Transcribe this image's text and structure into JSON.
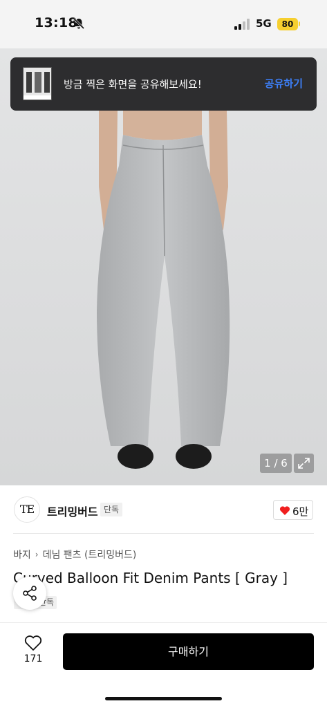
{
  "status_bar": {
    "time": "13:18",
    "network": "5G",
    "battery": "80",
    "icons": [
      "bell-slash-icon",
      "signal-icon"
    ]
  },
  "toast": {
    "message": "방금 찍은 화면을 공유해보세요!",
    "action": "공유하기"
  },
  "gallery": {
    "counter": "1 / 6",
    "expand_icon": "expand-icon"
  },
  "brand": {
    "logo_text": "TE",
    "name": "트리밍버드",
    "badge": "단독",
    "likes": "6만",
    "like_color": "#f01f1f"
  },
  "breadcrumb": [
    "바지",
    "데님 팬츠 (트리밍버드)"
  ],
  "product": {
    "title": "Curved Balloon Fit Denim Pants [ Gray ]",
    "badge": "단독"
  },
  "share_icon": "share-icon",
  "bottom_bar": {
    "wish_count": "171",
    "buy_label": "구매하기"
  },
  "colors": {
    "toast_bg": "#2d2d2f",
    "toast_action": "#3d7ff7",
    "battery": "#f6cf2f",
    "buy_button": "#000000"
  }
}
